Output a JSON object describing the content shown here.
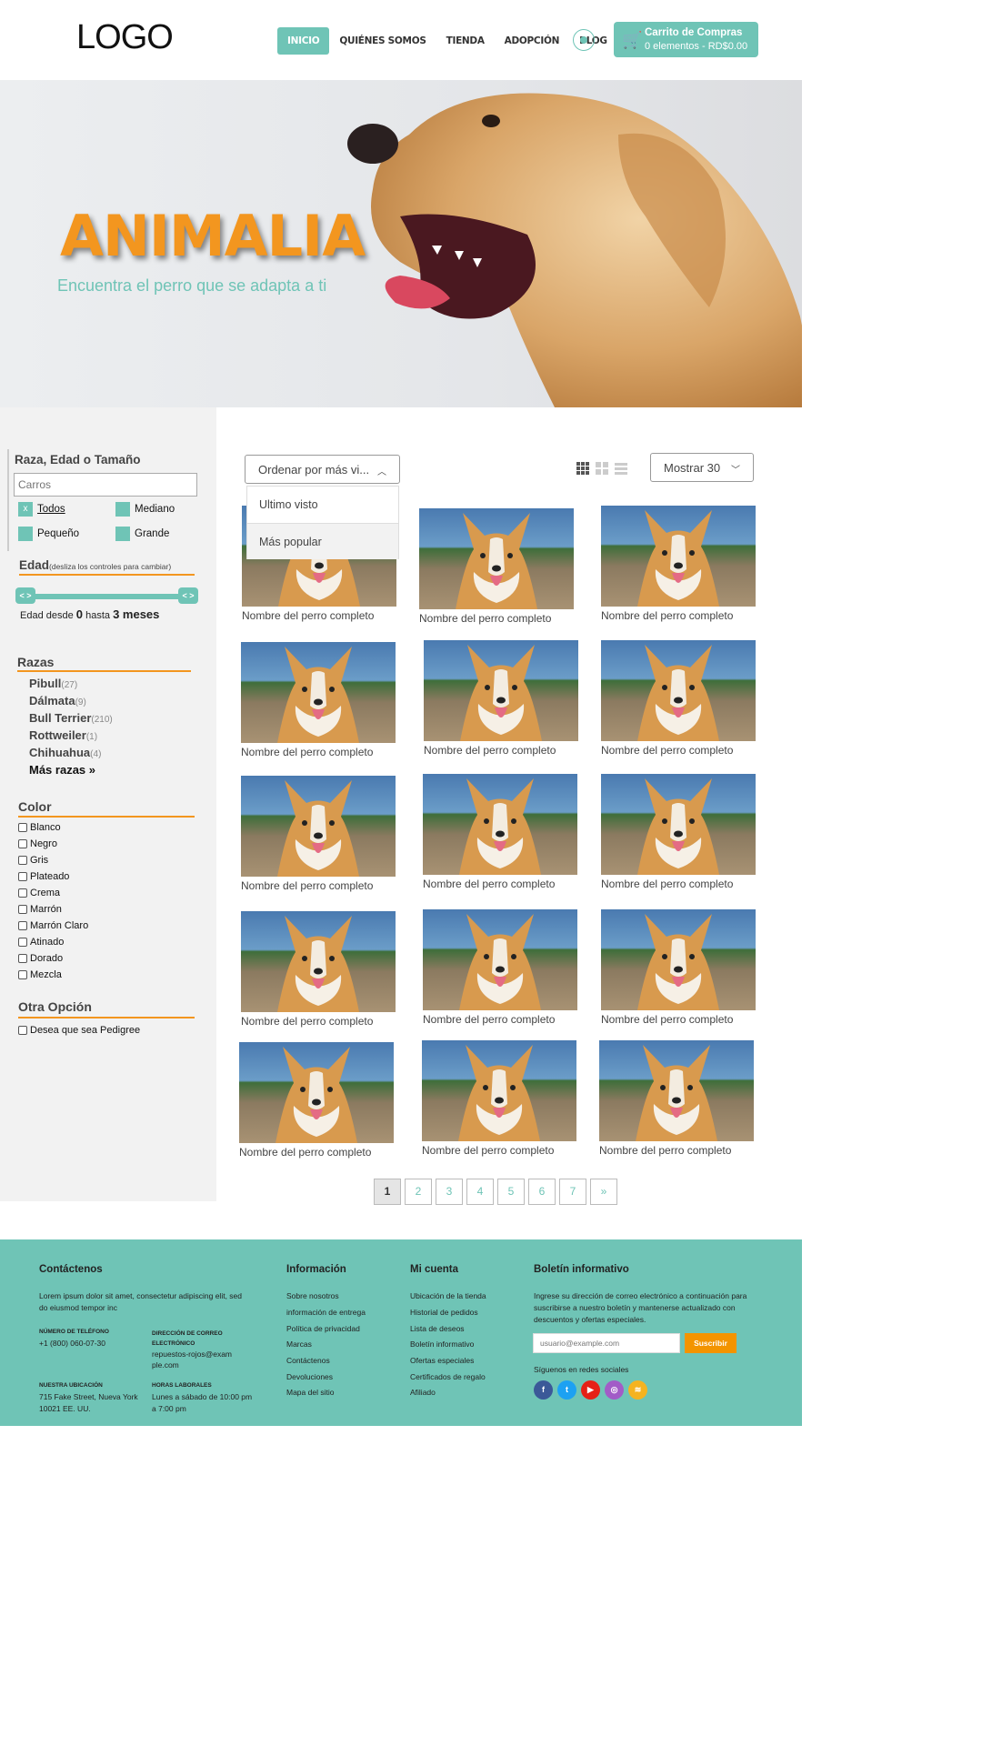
{
  "header": {
    "logo": "LOGO",
    "nav": [
      "INICIO",
      "QUIÉNES SOMOS",
      "TIENDA",
      "ADOPCIÓN",
      "BLOG"
    ],
    "cart_title": "Carrito de Compras",
    "cart_summary": "0 elementos - RD$0.00"
  },
  "hero": {
    "title": "ANIMALIA",
    "subtitle": "Encuentra el perro que se adapta a ti"
  },
  "sidebar": {
    "search_title": "Raza, Edad o Tamaño",
    "search_placeholder": "Carros",
    "sizes": [
      "Todos",
      "Mediano",
      "Pequeño",
      "Grande"
    ],
    "sizes_selected": "Todos",
    "age_title": "Edad",
    "age_hint": "(desliza los controles para cambiar)",
    "age_text_prefix": "Edad desde",
    "age_from": "0",
    "age_text_mid": "hasta",
    "age_to": "3 meses",
    "breeds_title": "Razas",
    "breeds": [
      {
        "name": "Pibull",
        "count": "(27)"
      },
      {
        "name": "Dálmata",
        "count": "(9)"
      },
      {
        "name": "Bull Terrier",
        "count": "(210)"
      },
      {
        "name": "Rottweiler",
        "count": "(1)"
      },
      {
        "name": "Chihuahua",
        "count": "(4)"
      }
    ],
    "more_breeds": "Más razas »",
    "color_title": "Color",
    "colors": [
      "Blanco",
      "Negro",
      "Gris",
      "Plateado",
      "Crema",
      "Marrón",
      "Marrón Claro",
      "Atinado",
      "Dorado",
      "Mezcla"
    ],
    "other_title": "Otra Opción",
    "pedigree": "Desea que sea Pedigree"
  },
  "toolbar": {
    "sort_label": "Ordenar por más vi...",
    "sort_options": [
      "Ultimo visto",
      "Más popular"
    ],
    "show_label": "Mostrar 30"
  },
  "products": {
    "card_name": "Nombre del perro completo",
    "items": [
      "Nombre del perro completo",
      "Nombre del perro completo",
      "Nombre del perro completo",
      "Nombre del perro completo",
      "Nombre del perro completo",
      "Nombre del perro completo",
      "Nombre del perro completo",
      "Nombre del perro completo",
      "Nombre del perro completo",
      "Nombre del perro completo",
      "Nombre del perro completo",
      "Nombre del perro completo",
      "Nombre del perro completo",
      "Nombre del perro completo",
      "Nombre del perro completo"
    ]
  },
  "pagination": [
    "1",
    "2",
    "3",
    "4",
    "5",
    "6",
    "7",
    "»"
  ],
  "footer": {
    "contact_title": "Contáctenos",
    "contact_text": "Lorem ipsum dolor sit amet, consectetur adipiscing elit, sed do eiusmod tempor inc",
    "phone_label": "NÚMERO DE TELÉFONO",
    "phone": "+1 (800) 060-07-30",
    "email_label": "DIRECCIÓN DE CORREO ELECTRÓNICO",
    "email": "repuestos-rojos@example.com",
    "location_label": "NUESTRA UBICACIÓN",
    "location": "715 Fake Street, Nueva York 10021 EE. UU.",
    "hours_label": "HORAS LABORALES",
    "hours": "Lunes a sábado de 10:00 pm a 7:00 pm",
    "info_title": "Información",
    "info_links": [
      "Sobre nosotros",
      "información de entrega",
      "Política de privacidad",
      "Marcas",
      "Contáctenos",
      "Devoluciones",
      "Mapa del sitio"
    ],
    "account_title": "Mi cuenta",
    "account_links": [
      "Ubicación de la tienda",
      "Historial de pedidos",
      "Lista de deseos",
      "Boletín informativo",
      "Ofertas especiales",
      "Certificados de regalo",
      "Afiliado"
    ],
    "newsletter_title": "Boletín informativo",
    "newsletter_text": "Ingrese su dirección de correo electrónico a continuación para suscribirse a nuestro boletín y mantenerse actualizado con descuentos y ofertas especiales.",
    "newsletter_placeholder": "usuario@example.com",
    "subscribe": "Suscribir",
    "social_title": "Síguenos en redes sociales"
  },
  "colors": {
    "accent": "#6fc4b6",
    "orange": "#f3961f"
  }
}
